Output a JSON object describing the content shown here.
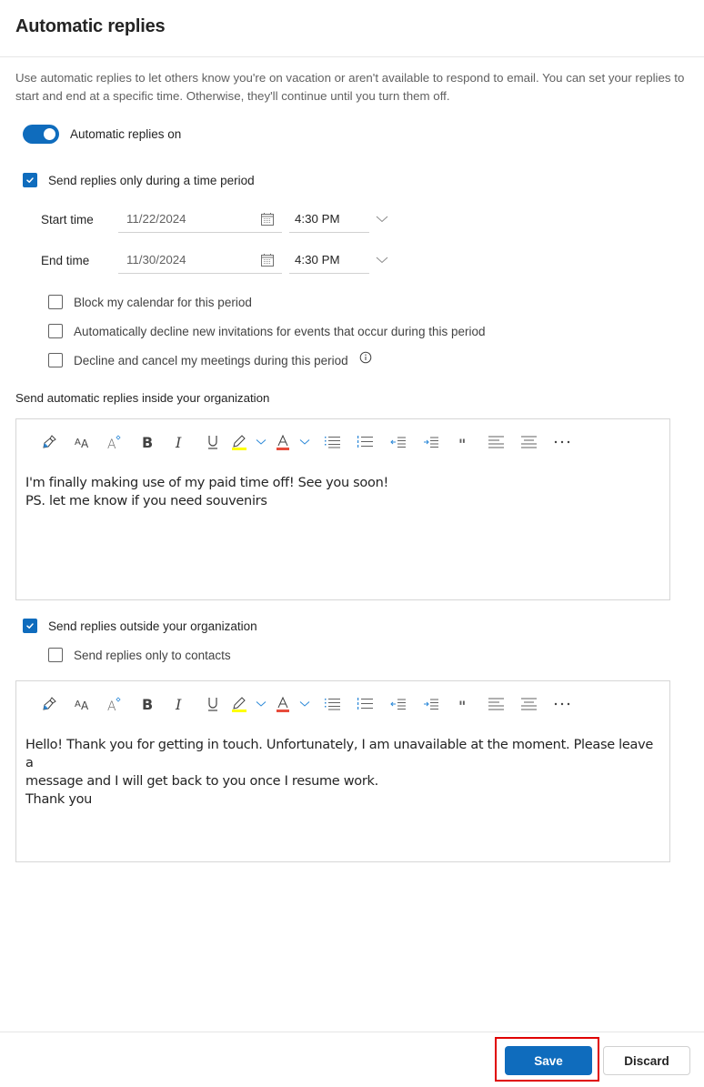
{
  "header": {
    "title": "Automatic replies"
  },
  "description": "Use automatic replies to let others know you're on vacation or aren't available to respond to email. You can set your replies to start and end at a specific time. Otherwise, they'll continue until you turn them off.",
  "toggle": {
    "label": "Automatic replies on",
    "on": true
  },
  "time_period": {
    "label": "Send replies only during a time period",
    "checked": true,
    "start": {
      "label": "Start time",
      "date": "11/22/2024",
      "time": "4:30 PM"
    },
    "end": {
      "label": "End time",
      "date": "11/30/2024",
      "time": "4:30 PM"
    }
  },
  "options": [
    {
      "label": "Block my calendar for this period",
      "checked": false
    },
    {
      "label": "Automatically decline new invitations for events that occur during this period",
      "checked": false
    },
    {
      "label": "Decline and cancel my meetings during this period",
      "checked": false,
      "info_icon": "info-icon"
    }
  ],
  "inside": {
    "label": "Send automatic replies inside your organization",
    "lines": [
      "I'm finally making use of my paid time off! See you soon!",
      "PS. let me know if you need souvenirs"
    ]
  },
  "outside": {
    "label": "Send replies outside your organization",
    "checked": true,
    "contacts_only": {
      "label": "Send replies only to contacts",
      "checked": false
    },
    "lines": [
      "Hello! Thank you for getting in touch. Unfortunately, I am unavailable at the moment. Please leave a",
      "message and I will get back to you once I resume work.",
      "Thank you"
    ]
  },
  "toolbar_icons": [
    "format-painter-icon",
    "font-size-icon",
    "text-effects-icon",
    "bold-icon",
    "italic-icon",
    "underline-icon",
    "highlight-icon",
    "font-color-icon",
    "bullets-icon",
    "numbering-icon",
    "decrease-indent-icon",
    "increase-indent-icon",
    "quote-icon",
    "align-left-icon",
    "align-center-icon",
    "more-options-icon"
  ],
  "colors": {
    "accent": "#0f6cbd",
    "highlight": "#ffff00",
    "font_color": "#e74c3c",
    "annotation": "#e00000"
  },
  "footer": {
    "save_label": "Save",
    "discard_label": "Discard"
  }
}
